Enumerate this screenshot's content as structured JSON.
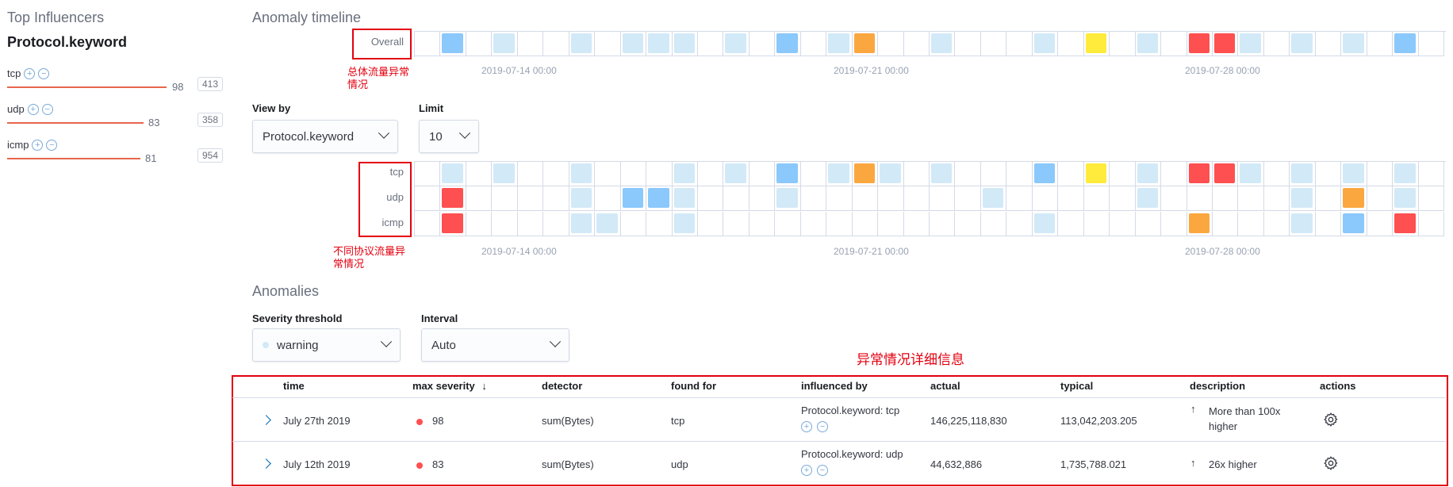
{
  "influencers": {
    "heading": "Top Influencers",
    "field": "Protocol.keyword",
    "items": [
      {
        "name": "tcp",
        "score": "98",
        "count": "413"
      },
      {
        "name": "udp",
        "score": "83",
        "count": "358"
      },
      {
        "name": "icmp",
        "score": "81",
        "count": "954"
      }
    ]
  },
  "timeline": {
    "title": "Anomaly timeline",
    "overall_label": "Overall",
    "ticks": [
      "2019-07-14 00:00",
      "2019-07-21 00:00",
      "2019-07-28 00:00"
    ],
    "annotation_overall": "总体流量异常情况",
    "annotation_lanes": "不同协议流量异常情况"
  },
  "view_by": {
    "label": "View by",
    "value": "Protocol.keyword"
  },
  "limit": {
    "label": "Limit",
    "value": "10"
  },
  "lanes": [
    "tcp",
    "udp",
    "icmp"
  ],
  "anomalies": {
    "title": "Anomalies",
    "severity_label": "Severity threshold",
    "severity_value": "warning",
    "interval_label": "Interval",
    "interval_value": "Auto",
    "annotation_table": "异常情况详细信息",
    "columns": {
      "time": "time",
      "max_severity": "max severity",
      "detector": "detector",
      "found_for": "found for",
      "influenced_by": "influenced by",
      "actual": "actual",
      "typical": "typical",
      "description": "description",
      "actions": "actions"
    },
    "rows": [
      {
        "time": "July 27th 2019",
        "severity": "98",
        "detector": "sum(Bytes)",
        "found_for": "tcp",
        "influenced_by": "Protocol.keyword: tcp",
        "actual": "146,225,118,830",
        "typical": "113,042,203.205",
        "description_line1": "More than 100x",
        "description_line2": "higher"
      },
      {
        "time": "July 12th 2019",
        "severity": "83",
        "detector": "sum(Bytes)",
        "found_for": "udp",
        "influenced_by": "Protocol.keyword: udp",
        "actual": "44,632,886",
        "typical": "1,735,788.021",
        "description_line1": "26x higher",
        "description_line2": ""
      }
    ]
  },
  "colors": {
    "light_blue": "#d2e9f7",
    "blue": "#8bc8fb",
    "yellow": "#ffeb3b",
    "orange": "#fba740",
    "red": "#fe5050",
    "annotation_red": "#e3000f"
  },
  "swimlane_cells": {
    "overall": {
      "1": "b",
      "3": "l",
      "6": "l",
      "8": "l",
      "9": "l",
      "10": "l",
      "12": "l",
      "14": "b",
      "16": "l",
      "17": "o",
      "20": "l",
      "24": "l",
      "26": "y",
      "28": "l",
      "30": "r",
      "31": "r",
      "32": "l",
      "34": "l",
      "36": "l",
      "38": "b"
    },
    "tcp": {
      "1": "l",
      "3": "l",
      "6": "l",
      "10": "l",
      "12": "l",
      "14": "b",
      "16": "l",
      "17": "o",
      "18": "l",
      "20": "l",
      "24": "b",
      "26": "y",
      "28": "l",
      "30": "r",
      "31": "r",
      "32": "l",
      "34": "l",
      "36": "l",
      "38": "l"
    },
    "udp": {
      "1": "r",
      "6": "l",
      "8": "b",
      "9": "b",
      "10": "l",
      "14": "l",
      "22": "l",
      "28": "l",
      "34": "l",
      "36": "o",
      "38": "l"
    },
    "icmp": {
      "1": "r",
      "6": "l",
      "7": "l",
      "10": "l",
      "24": "l",
      "30": "o",
      "34": "l",
      "36": "b",
      "38": "r"
    }
  }
}
